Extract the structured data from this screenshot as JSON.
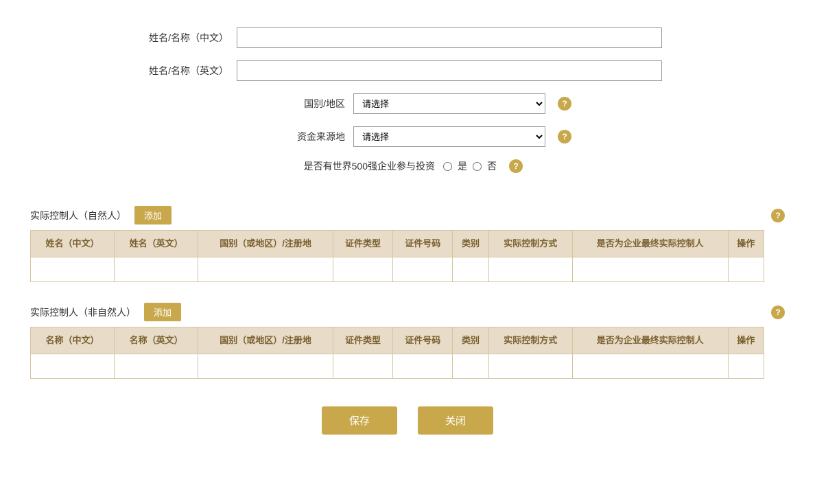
{
  "form": {
    "name_cn_label": "姓名/名称（中文）",
    "name_en_label": "姓名/名称（英文）",
    "country_label": "国别/地区",
    "fund_source_label": "资金来源地",
    "fortune500_label": "是否有世界500强企业参与投资",
    "radio_yes": "是",
    "radio_no": "否",
    "select_placeholder": "请选择",
    "name_cn_value": "",
    "name_en_value": ""
  },
  "natural_person_section": {
    "title": "实际控制人（自然人）",
    "add_button": "添加",
    "columns": [
      "姓名（中文）",
      "姓名（英文）",
      "国别（或地区）/注册地",
      "证件类型",
      "证件号码",
      "类别",
      "实际控制方式",
      "是否为企业最终实际控制人",
      "操作"
    ]
  },
  "non_natural_person_section": {
    "title": "实际控制人（非自然人）",
    "add_button": "添加",
    "columns": [
      "名称（中文）",
      "名称（英文）",
      "国别（或地区）/注册地",
      "证件类型",
      "证件号码",
      "类别",
      "实际控制方式",
      "是否为企业最终实际控制人",
      "操作"
    ]
  },
  "buttons": {
    "save": "保存",
    "close": "关闭"
  },
  "icons": {
    "help": "?",
    "dropdown": "▾"
  }
}
